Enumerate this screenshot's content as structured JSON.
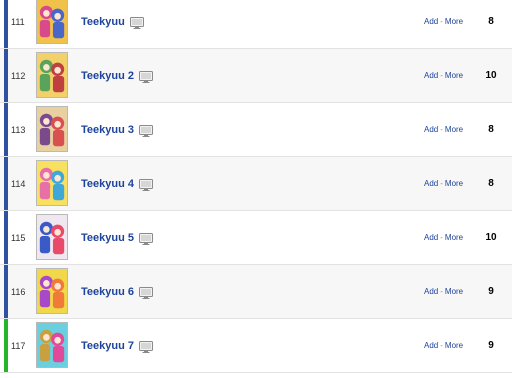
{
  "colors": {
    "watching": "#2e51a2",
    "completed": "#26b526",
    "link": "#1d439b"
  },
  "icons": {
    "type": "tv-icon"
  },
  "entries": [
    {
      "num": "111",
      "title": "Teekyuu",
      "add": "Add",
      "sep": "-",
      "more": "More",
      "score": "8",
      "status_color": "#2e51a2",
      "cover_colors": [
        "#d94a8c",
        "#4a66c9",
        "#f0c24a"
      ]
    },
    {
      "num": "112",
      "title": "Teekyuu 2",
      "add": "Add",
      "sep": "-",
      "more": "More",
      "score": "10",
      "status_color": "#2e51a2",
      "cover_colors": [
        "#5aa35a",
        "#c04040",
        "#f2d06a"
      ]
    },
    {
      "num": "113",
      "title": "Teekyuu 3",
      "add": "Add",
      "sep": "-",
      "more": "More",
      "score": "8",
      "status_color": "#2e51a2",
      "cover_colors": [
        "#7a4a8c",
        "#d85050",
        "#e8d0a0"
      ]
    },
    {
      "num": "114",
      "title": "Teekyuu 4",
      "add": "Add",
      "sep": "-",
      "more": "More",
      "score": "8",
      "status_color": "#2e51a2",
      "cover_colors": [
        "#e870a8",
        "#40a8d8",
        "#f8e060"
      ]
    },
    {
      "num": "115",
      "title": "Teekyuu 5",
      "add": "Add",
      "sep": "-",
      "more": "More",
      "score": "10",
      "status_color": "#2e51a2",
      "cover_colors": [
        "#3a5ac8",
        "#e84a6a",
        "#f0e8f0"
      ]
    },
    {
      "num": "116",
      "title": "Teekyuu 6",
      "add": "Add",
      "sep": "-",
      "more": "More",
      "score": "9",
      "status_color": "#2e51a2",
      "cover_colors": [
        "#a84ac8",
        "#f07a3a",
        "#f0d84a"
      ]
    },
    {
      "num": "117",
      "title": "Teekyuu 7",
      "add": "Add",
      "sep": "-",
      "more": "More",
      "score": "9",
      "status_color": "#26b526",
      "cover_colors": [
        "#c8a040",
        "#e04a9a",
        "#6ad0e0"
      ]
    }
  ]
}
